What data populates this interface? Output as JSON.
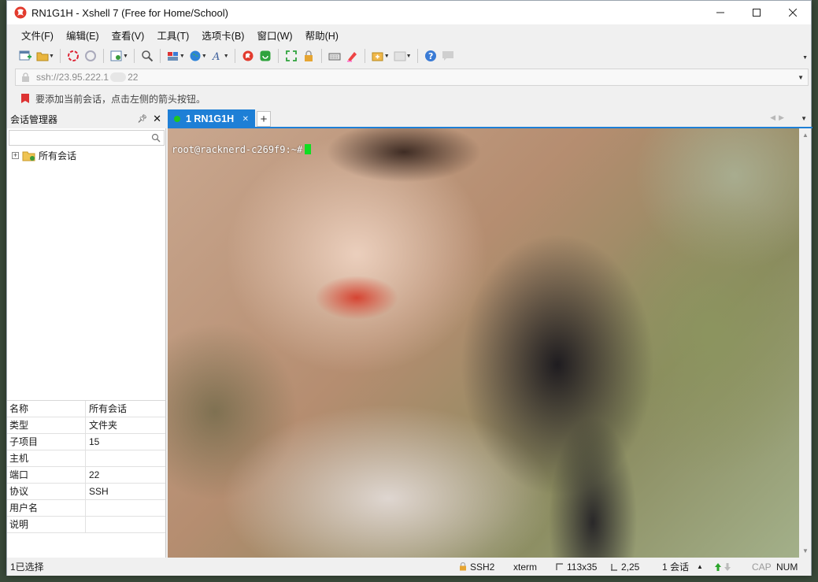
{
  "window": {
    "title": "RN1G1H - Xshell 7 (Free for Home/School)"
  },
  "menu": {
    "items": [
      "文件(F)",
      "编辑(E)",
      "查看(V)",
      "工具(T)",
      "选项卡(B)",
      "窗口(W)",
      "帮助(H)"
    ]
  },
  "address": {
    "text": "ssh://23.95.222.1",
    "port_suffix": "22"
  },
  "hint": {
    "text": "要添加当前会话，点击左侧的箭头按钮。"
  },
  "sessions": {
    "title": "会话管理器",
    "tree_root": "所有会话",
    "properties": [
      {
        "key": "名称",
        "value": "所有会话"
      },
      {
        "key": "类型",
        "value": "文件夹"
      },
      {
        "key": "子项目",
        "value": "15"
      },
      {
        "key": "主机",
        "value": ""
      },
      {
        "key": "端口",
        "value": "22"
      },
      {
        "key": "协议",
        "value": "SSH"
      },
      {
        "key": "用户名",
        "value": ""
      },
      {
        "key": "说明",
        "value": ""
      }
    ]
  },
  "tab": {
    "label": "1 RN1G1H"
  },
  "terminal": {
    "prompt": "root@racknerd-c269f9:~#"
  },
  "status": {
    "selected": "1已选择",
    "protocol": "SSH2",
    "term": "xterm",
    "size": "113x35",
    "cursor": "2,25",
    "sessions": "1 会话",
    "cap": "CAP",
    "num": "NUM"
  },
  "colors": {
    "tab_accent": "#1e7fd6",
    "cursor": "#11dd22"
  }
}
